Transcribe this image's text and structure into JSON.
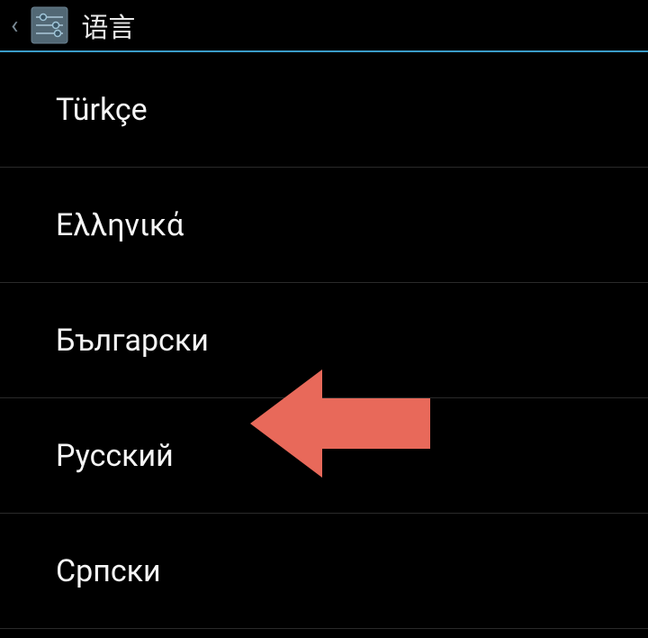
{
  "header": {
    "title": "语言"
  },
  "languages": [
    {
      "label": "Türkçe"
    },
    {
      "label": "Ελληνικά"
    },
    {
      "label": "Български"
    },
    {
      "label": "Русский"
    },
    {
      "label": "Српски"
    }
  ],
  "annotation": {
    "target_index": 3
  }
}
